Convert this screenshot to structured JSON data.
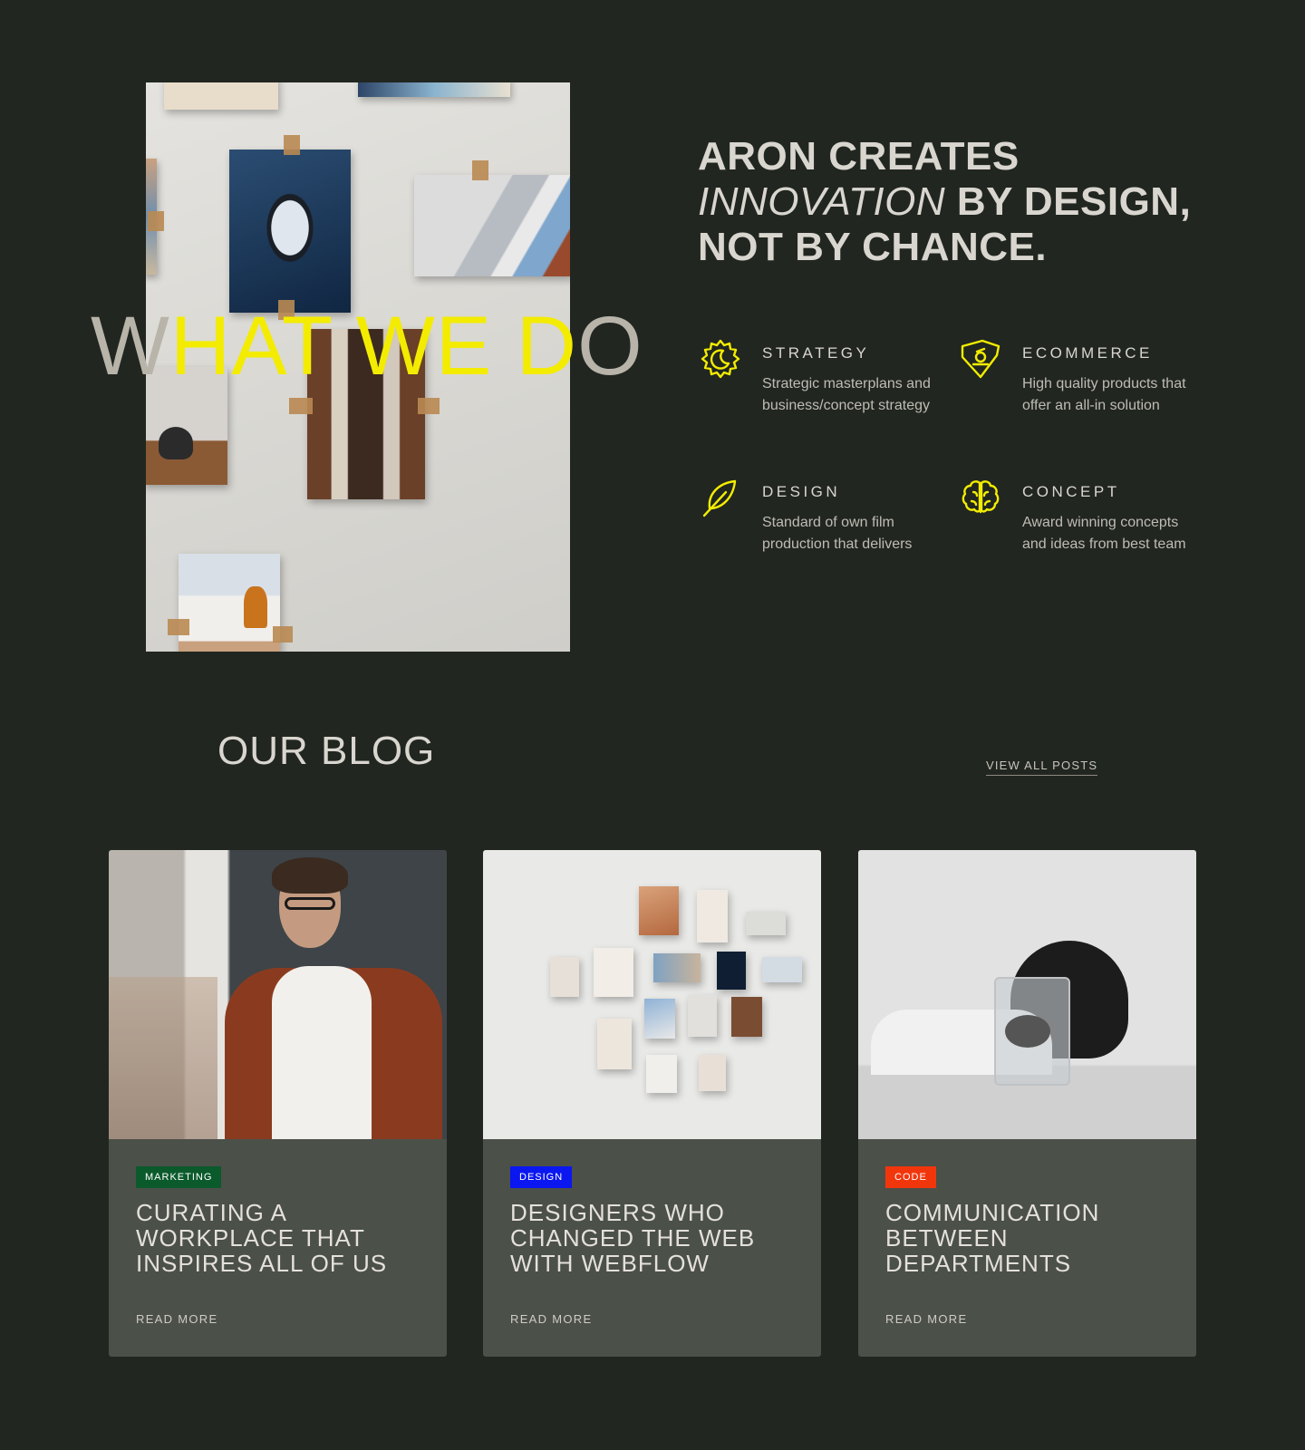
{
  "colors": {
    "background": "#212620",
    "accent_yellow": "#f3ec00",
    "card_background": "#4b5049",
    "tag_marketing": "#0b5a2c",
    "tag_design": "#0a17f0",
    "tag_code": "#f2360c"
  },
  "about": {
    "section_title_part1": "W",
    "section_title_part2": "HAT WE D",
    "section_title_part3": "O",
    "headline_line1": "ARON CREATES",
    "headline_em": "INNOVATION",
    "headline_line2_rest": " BY DESIGN,",
    "headline_line3": "NOT BY CHANCE.",
    "services": [
      {
        "icon": "sun-moon-icon",
        "title": "STRATEGY",
        "description": "Strategic masterplans and business/concept strategy"
      },
      {
        "icon": "price-tag-icon",
        "title": "ECOMMERCE",
        "description": "High quality products that offer an all-in solution"
      },
      {
        "icon": "feather-icon",
        "title": "DESIGN",
        "description": "Standard of own film production that delivers"
      },
      {
        "icon": "brain-icon",
        "title": "CONCEPT",
        "description": "Award winning concepts and ideas from best team"
      }
    ]
  },
  "blog": {
    "title": "OUR BLOG",
    "view_all": "VIEW ALL POSTS",
    "posts": [
      {
        "tag": "MARKETING",
        "title": "CURATING A WORKPLACE THAT INSPIRES ALL OF US",
        "read_more": "READ MORE"
      },
      {
        "tag": "DESIGN",
        "title": "DESIGNERS WHO CHANGED THE WEB WITH WEBFLOW",
        "read_more": "READ MORE"
      },
      {
        "tag": "CODE",
        "title": "COMMUNICATION BETWEEN DEPARTMENTS",
        "read_more": "READ MORE"
      }
    ]
  }
}
